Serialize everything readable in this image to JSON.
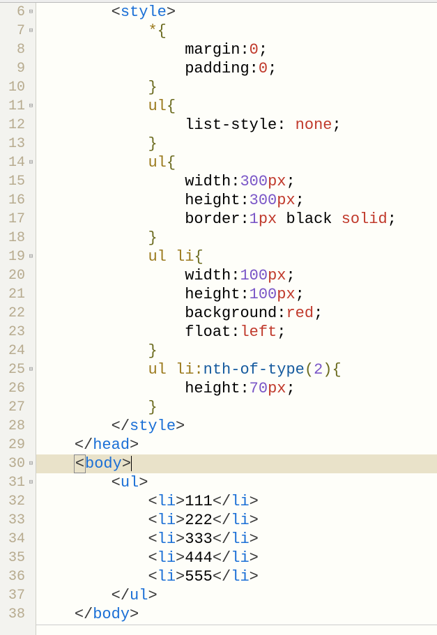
{
  "editor": {
    "line_start": 6,
    "highlighted_line": 30,
    "rows": [
      {
        "n": 6,
        "fold": "⊟",
        "tokens": [
          {
            "t": "        ",
            "c": ""
          },
          {
            "t": "<",
            "c": "c-angle"
          },
          {
            "t": "style",
            "c": "c-tag"
          },
          {
            "t": ">",
            "c": "c-angle"
          }
        ]
      },
      {
        "n": 7,
        "fold": "⊟",
        "tokens": [
          {
            "t": "            ",
            "c": ""
          },
          {
            "t": "*",
            "c": "c-sel"
          },
          {
            "t": "{",
            "c": "c-dkolive"
          }
        ]
      },
      {
        "n": 8,
        "fold": "",
        "tokens": [
          {
            "t": "                ",
            "c": ""
          },
          {
            "t": "margin:",
            "c": "c-black"
          },
          {
            "t": "0",
            "c": "c-kwred"
          },
          {
            "t": ";",
            "c": "c-black"
          }
        ]
      },
      {
        "n": 9,
        "fold": "",
        "tokens": [
          {
            "t": "                ",
            "c": ""
          },
          {
            "t": "padding:",
            "c": "c-black"
          },
          {
            "t": "0",
            "c": "c-kwred"
          },
          {
            "t": ";",
            "c": "c-black"
          }
        ]
      },
      {
        "n": 10,
        "fold": "",
        "tokens": [
          {
            "t": "            ",
            "c": ""
          },
          {
            "t": "}",
            "c": "c-dkolive"
          }
        ]
      },
      {
        "n": 11,
        "fold": "⊟",
        "tokens": [
          {
            "t": "            ",
            "c": ""
          },
          {
            "t": "ul",
            "c": "c-sel"
          },
          {
            "t": "{",
            "c": "c-dkolive"
          }
        ]
      },
      {
        "n": 12,
        "fold": "",
        "tokens": [
          {
            "t": "                ",
            "c": ""
          },
          {
            "t": "list-style: ",
            "c": "c-black"
          },
          {
            "t": "none",
            "c": "c-kwred"
          },
          {
            "t": ";",
            "c": "c-black"
          }
        ]
      },
      {
        "n": 13,
        "fold": "",
        "tokens": [
          {
            "t": "            ",
            "c": ""
          },
          {
            "t": "}",
            "c": "c-dkolive"
          }
        ]
      },
      {
        "n": 14,
        "fold": "⊟",
        "tokens": [
          {
            "t": "            ",
            "c": ""
          },
          {
            "t": "ul",
            "c": "c-sel"
          },
          {
            "t": "{",
            "c": "c-dkolive"
          }
        ]
      },
      {
        "n": 15,
        "fold": "",
        "tokens": [
          {
            "t": "                ",
            "c": ""
          },
          {
            "t": "width:",
            "c": "c-black"
          },
          {
            "t": "300",
            "c": "c-unit"
          },
          {
            "t": "px",
            "c": "c-kwred"
          },
          {
            "t": ";",
            "c": "c-black"
          }
        ]
      },
      {
        "n": 16,
        "fold": "",
        "tokens": [
          {
            "t": "                ",
            "c": ""
          },
          {
            "t": "height:",
            "c": "c-black"
          },
          {
            "t": "300",
            "c": "c-unit"
          },
          {
            "t": "px",
            "c": "c-kwred"
          },
          {
            "t": ";",
            "c": "c-black"
          }
        ]
      },
      {
        "n": 17,
        "fold": "",
        "tokens": [
          {
            "t": "                ",
            "c": ""
          },
          {
            "t": "border:",
            "c": "c-black"
          },
          {
            "t": "1",
            "c": "c-unit"
          },
          {
            "t": "px",
            "c": "c-kwred"
          },
          {
            "t": " black ",
            "c": "c-black"
          },
          {
            "t": "solid",
            "c": "c-kwred"
          },
          {
            "t": ";",
            "c": "c-black"
          }
        ]
      },
      {
        "n": 18,
        "fold": "",
        "tokens": [
          {
            "t": "            ",
            "c": ""
          },
          {
            "t": "}",
            "c": "c-dkolive"
          }
        ]
      },
      {
        "n": 19,
        "fold": "⊟",
        "tokens": [
          {
            "t": "            ",
            "c": ""
          },
          {
            "t": "ul li",
            "c": "c-sel"
          },
          {
            "t": "{",
            "c": "c-dkolive"
          }
        ]
      },
      {
        "n": 20,
        "fold": "",
        "tokens": [
          {
            "t": "                ",
            "c": ""
          },
          {
            "t": "width:",
            "c": "c-black"
          },
          {
            "t": "100",
            "c": "c-unit"
          },
          {
            "t": "px",
            "c": "c-kwred"
          },
          {
            "t": ";",
            "c": "c-black"
          }
        ]
      },
      {
        "n": 21,
        "fold": "",
        "tokens": [
          {
            "t": "                ",
            "c": ""
          },
          {
            "t": "height:",
            "c": "c-black"
          },
          {
            "t": "100",
            "c": "c-unit"
          },
          {
            "t": "px",
            "c": "c-kwred"
          },
          {
            "t": ";",
            "c": "c-black"
          }
        ]
      },
      {
        "n": 22,
        "fold": "",
        "tokens": [
          {
            "t": "                ",
            "c": ""
          },
          {
            "t": "background:",
            "c": "c-black"
          },
          {
            "t": "red",
            "c": "c-kwred"
          },
          {
            "t": ";",
            "c": "c-black"
          }
        ]
      },
      {
        "n": 23,
        "fold": "",
        "tokens": [
          {
            "t": "                ",
            "c": ""
          },
          {
            "t": "float:",
            "c": "c-black"
          },
          {
            "t": "left",
            "c": "c-kwred"
          },
          {
            "t": ";",
            "c": "c-black"
          }
        ]
      },
      {
        "n": 24,
        "fold": "",
        "tokens": [
          {
            "t": "            ",
            "c": ""
          },
          {
            "t": "}",
            "c": "c-dkolive"
          }
        ]
      },
      {
        "n": 25,
        "fold": "⊟",
        "tokens": [
          {
            "t": "            ",
            "c": ""
          },
          {
            "t": "ul li",
            "c": "c-sel"
          },
          {
            "t": ":",
            "c": "c-sel"
          },
          {
            "t": "nth-of-type",
            "c": "c-ident"
          },
          {
            "t": "(",
            "c": "c-dkolive"
          },
          {
            "t": "2",
            "c": "c-unit"
          },
          {
            "t": ")",
            "c": "c-dkolive"
          },
          {
            "t": "{",
            "c": "c-dkolive"
          }
        ]
      },
      {
        "n": 26,
        "fold": "",
        "tokens": [
          {
            "t": "                ",
            "c": ""
          },
          {
            "t": "height:",
            "c": "c-black"
          },
          {
            "t": "70",
            "c": "c-unit"
          },
          {
            "t": "px",
            "c": "c-kwred"
          },
          {
            "t": ";",
            "c": "c-black"
          }
        ]
      },
      {
        "n": 27,
        "fold": "",
        "tokens": [
          {
            "t": "            ",
            "c": ""
          },
          {
            "t": "}",
            "c": "c-dkolive"
          }
        ]
      },
      {
        "n": 28,
        "fold": "",
        "tokens": [
          {
            "t": "        ",
            "c": ""
          },
          {
            "t": "</",
            "c": "c-angle"
          },
          {
            "t": "style",
            "c": "c-tag"
          },
          {
            "t": ">",
            "c": "c-angle"
          }
        ]
      },
      {
        "n": 29,
        "fold": "",
        "tokens": [
          {
            "t": "    ",
            "c": ""
          },
          {
            "t": "</",
            "c": "c-angle"
          },
          {
            "t": "head",
            "c": "c-tag"
          },
          {
            "t": ">",
            "c": "c-angle"
          }
        ]
      },
      {
        "n": 30,
        "fold": "⊟",
        "hl": true,
        "caret": true,
        "tokens": [
          {
            "t": "    ",
            "c": ""
          },
          {
            "t": "<",
            "c": "c-angle box"
          },
          {
            "t": "body",
            "c": "c-tag"
          },
          {
            "t": ">",
            "c": "c-angle"
          }
        ]
      },
      {
        "n": 31,
        "fold": "⊟",
        "tokens": [
          {
            "t": "        ",
            "c": ""
          },
          {
            "t": "<",
            "c": "c-angle"
          },
          {
            "t": "ul",
            "c": "c-tag"
          },
          {
            "t": ">",
            "c": "c-angle"
          }
        ]
      },
      {
        "n": 32,
        "fold": "",
        "tokens": [
          {
            "t": "            ",
            "c": ""
          },
          {
            "t": "<",
            "c": "c-angle"
          },
          {
            "t": "li",
            "c": "c-tag"
          },
          {
            "t": ">",
            "c": "c-angle"
          },
          {
            "t": "111",
            "c": "c-black"
          },
          {
            "t": "</",
            "c": "c-angle"
          },
          {
            "t": "li",
            "c": "c-tag"
          },
          {
            "t": ">",
            "c": "c-angle"
          }
        ]
      },
      {
        "n": 33,
        "fold": "",
        "tokens": [
          {
            "t": "            ",
            "c": ""
          },
          {
            "t": "<",
            "c": "c-angle"
          },
          {
            "t": "li",
            "c": "c-tag"
          },
          {
            "t": ">",
            "c": "c-angle"
          },
          {
            "t": "222",
            "c": "c-black"
          },
          {
            "t": "</",
            "c": "c-angle"
          },
          {
            "t": "li",
            "c": "c-tag"
          },
          {
            "t": ">",
            "c": "c-angle"
          }
        ]
      },
      {
        "n": 34,
        "fold": "",
        "tokens": [
          {
            "t": "            ",
            "c": ""
          },
          {
            "t": "<",
            "c": "c-angle"
          },
          {
            "t": "li",
            "c": "c-tag"
          },
          {
            "t": ">",
            "c": "c-angle"
          },
          {
            "t": "333",
            "c": "c-black"
          },
          {
            "t": "</",
            "c": "c-angle"
          },
          {
            "t": "li",
            "c": "c-tag"
          },
          {
            "t": ">",
            "c": "c-angle"
          }
        ]
      },
      {
        "n": 35,
        "fold": "",
        "tokens": [
          {
            "t": "            ",
            "c": ""
          },
          {
            "t": "<",
            "c": "c-angle"
          },
          {
            "t": "li",
            "c": "c-tag"
          },
          {
            "t": ">",
            "c": "c-angle"
          },
          {
            "t": "444",
            "c": "c-black"
          },
          {
            "t": "</",
            "c": "c-angle"
          },
          {
            "t": "li",
            "c": "c-tag"
          },
          {
            "t": ">",
            "c": "c-angle"
          }
        ]
      },
      {
        "n": 36,
        "fold": "",
        "tokens": [
          {
            "t": "            ",
            "c": ""
          },
          {
            "t": "<",
            "c": "c-angle"
          },
          {
            "t": "li",
            "c": "c-tag"
          },
          {
            "t": ">",
            "c": "c-angle"
          },
          {
            "t": "555",
            "c": "c-black"
          },
          {
            "t": "</",
            "c": "c-angle"
          },
          {
            "t": "li",
            "c": "c-tag"
          },
          {
            "t": ">",
            "c": "c-angle"
          }
        ]
      },
      {
        "n": 37,
        "fold": "",
        "tokens": [
          {
            "t": "        ",
            "c": ""
          },
          {
            "t": "</",
            "c": "c-angle"
          },
          {
            "t": "ul",
            "c": "c-tag"
          },
          {
            "t": ">",
            "c": "c-angle"
          }
        ]
      },
      {
        "n": 38,
        "fold": "",
        "last": true,
        "tokens": [
          {
            "t": "    ",
            "c": ""
          },
          {
            "t": "</",
            "c": "c-angle"
          },
          {
            "t": "body",
            "c": "c-tag"
          },
          {
            "t": ">",
            "c": "c-angle"
          }
        ]
      }
    ]
  }
}
